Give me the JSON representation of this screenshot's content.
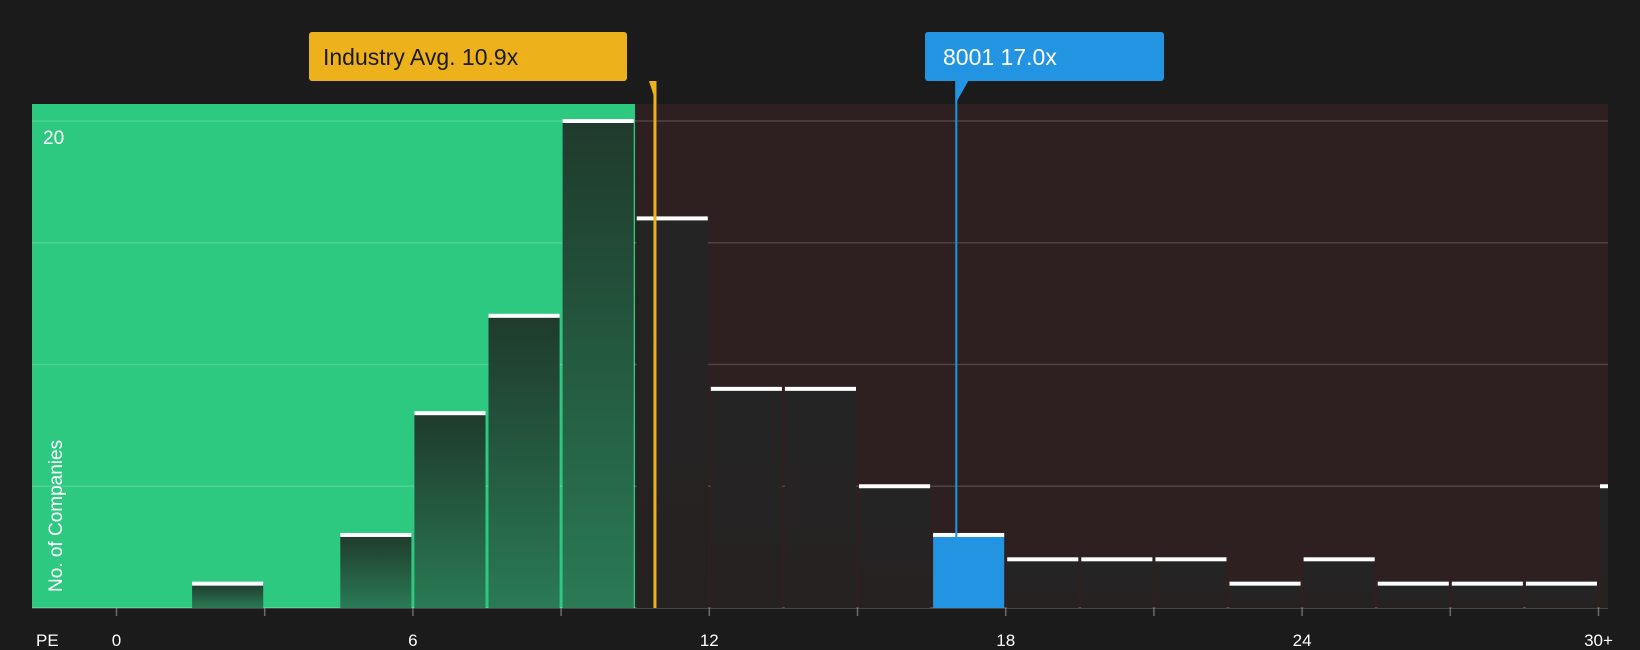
{
  "colors": {
    "background": "#1b1b1b",
    "below_region": "#2ec980",
    "above_region": "#2e1f20",
    "industry_accent": "#edb11b",
    "company_accent": "#2394e2",
    "bar_dark": "#222222",
    "bar_cap": "#ffffff"
  },
  "callouts": {
    "industry": {
      "text": "Industry Avg. 10.9x",
      "value": 10.9
    },
    "company": {
      "text": "8001 17.0x",
      "value": 17.0
    }
  },
  "chart_data": {
    "type": "bar",
    "metric": "PE",
    "xlabel": "PE",
    "ylabel": "No. of Companies",
    "xlim": [
      0,
      30.5
    ],
    "ylim": [
      0,
      20.7
    ],
    "x_ticks": [
      0,
      6,
      12,
      18,
      24,
      30
    ],
    "x_tick_labels": [
      "0",
      "6",
      "12",
      "18",
      "24",
      "30+"
    ],
    "y_tick_labels": [
      "20"
    ],
    "y_gridlines": [
      5,
      10,
      15,
      20
    ],
    "bin_width": 1.5,
    "bins": [
      {
        "x0": 1.5,
        "count": 1
      },
      {
        "x0": 4.5,
        "count": 3
      },
      {
        "x0": 6.0,
        "count": 8
      },
      {
        "x0": 7.5,
        "count": 12
      },
      {
        "x0": 9.0,
        "count": 20
      },
      {
        "x0": 10.5,
        "count": 16
      },
      {
        "x0": 12.0,
        "count": 9
      },
      {
        "x0": 13.5,
        "count": 9
      },
      {
        "x0": 15.0,
        "count": 5
      },
      {
        "x0": 16.5,
        "count": 3,
        "highlight": true
      },
      {
        "x0": 18.0,
        "count": 2
      },
      {
        "x0": 19.5,
        "count": 2
      },
      {
        "x0": 21.0,
        "count": 2
      },
      {
        "x0": 22.5,
        "count": 1
      },
      {
        "x0": 24.0,
        "count": 2
      },
      {
        "x0": 25.5,
        "count": 1
      },
      {
        "x0": 27.0,
        "count": 1
      },
      {
        "x0": 28.5,
        "count": 1
      },
      {
        "x0": 30.0,
        "count": 5
      }
    ],
    "industry_avg": 10.9,
    "company_value": 17.0
  }
}
